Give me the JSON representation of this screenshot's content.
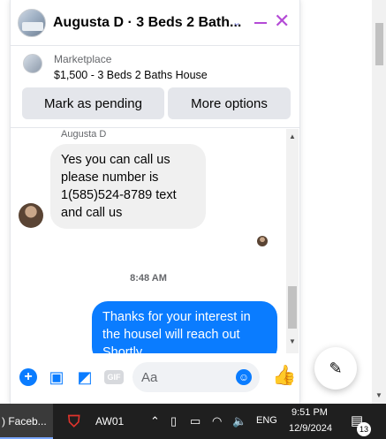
{
  "chat": {
    "title": "Augusta D · 3 Beds 2 Bath...",
    "chevron": "⌄",
    "close": "✕"
  },
  "listing": {
    "source": "Marketplace",
    "description": "$1,500 - 3 Beds 2 Baths House",
    "mark_pending_label": "Mark as pending",
    "more_options_label": "More options"
  },
  "messages": {
    "sender_name": "Augusta D",
    "incoming_text": "Yes you can call us please number is 1(585)524-8789 text and call us",
    "timestamp": "8:48 AM",
    "outgoing_text": "Thanks for your interest in the housel will reach out Shortly"
  },
  "composer": {
    "placeholder": "Aa",
    "gif_label": "GIF"
  },
  "taskbar": {
    "facebook_label": ") Faceb...",
    "app_label": "AW01",
    "language": "ENG",
    "time": "9:51 PM",
    "date": "12/9/2024",
    "notification_count": "13"
  }
}
